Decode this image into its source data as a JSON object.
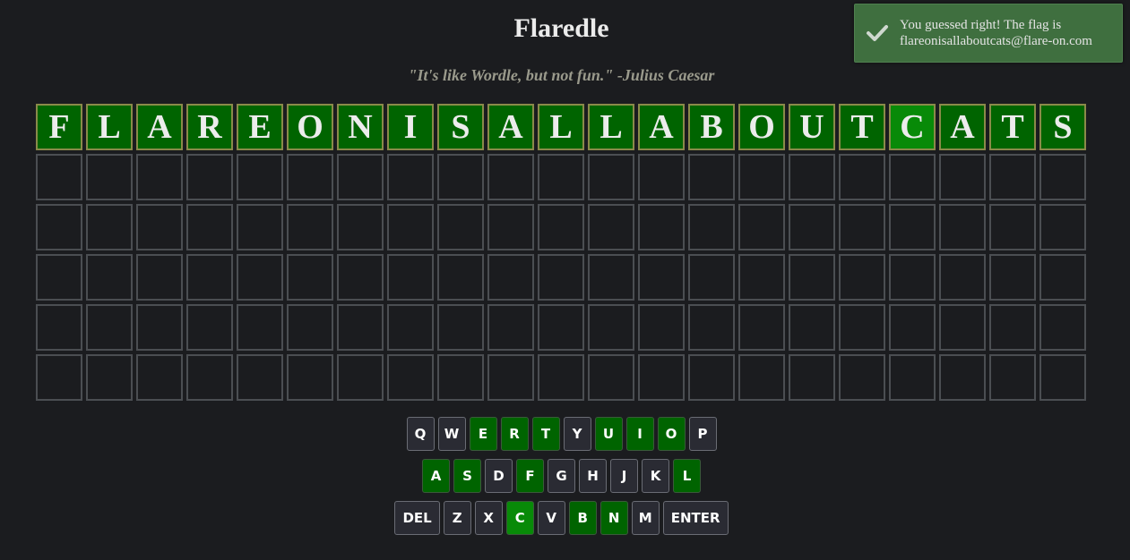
{
  "header": {
    "title": "Flaredle",
    "subtitle": "\"It's like Wordle, but not fun.\" -Julius Caesar"
  },
  "toast": {
    "icon": "check-icon",
    "line1": "You guessed right! The flag is",
    "line2": "flareonisallaboutcats@flare-on.com"
  },
  "board": {
    "columns": 21,
    "rows": 6,
    "guesses": [
      [
        "F",
        "L",
        "A",
        "R",
        "E",
        "O",
        "N",
        "I",
        "S",
        "A",
        "L",
        "L",
        "A",
        "B",
        "O",
        "U",
        "T",
        "C",
        "A",
        "T",
        "S"
      ]
    ]
  },
  "keyboard": {
    "rows": [
      [
        {
          "label": "Q",
          "state": "unused"
        },
        {
          "label": "W",
          "state": "unused"
        },
        {
          "label": "E",
          "state": "correct"
        },
        {
          "label": "R",
          "state": "correct"
        },
        {
          "label": "T",
          "state": "correct"
        },
        {
          "label": "Y",
          "state": "unused"
        },
        {
          "label": "U",
          "state": "correct"
        },
        {
          "label": "I",
          "state": "correct"
        },
        {
          "label": "O",
          "state": "correct"
        },
        {
          "label": "P",
          "state": "unused"
        }
      ],
      [
        {
          "label": "A",
          "state": "correct"
        },
        {
          "label": "S",
          "state": "correct"
        },
        {
          "label": "D",
          "state": "unused"
        },
        {
          "label": "F",
          "state": "correct"
        },
        {
          "label": "G",
          "state": "unused"
        },
        {
          "label": "H",
          "state": "unused"
        },
        {
          "label": "J",
          "state": "unused"
        },
        {
          "label": "K",
          "state": "unused"
        },
        {
          "label": "L",
          "state": "correct"
        }
      ],
      [
        {
          "label": "DEL",
          "state": "unused"
        },
        {
          "label": "Z",
          "state": "unused"
        },
        {
          "label": "X",
          "state": "unused"
        },
        {
          "label": "C",
          "state": "correct"
        },
        {
          "label": "V",
          "state": "unused"
        },
        {
          "label": "B",
          "state": "correct"
        },
        {
          "label": "N",
          "state": "correct"
        },
        {
          "label": "M",
          "state": "unused"
        },
        {
          "label": "ENTER",
          "state": "unused"
        }
      ]
    ]
  },
  "colors": {
    "background": "#1b1c1f",
    "correct": "#006400",
    "correct_bright": "#088a08",
    "toast": "#3f6f3f",
    "key": "#2a2b33",
    "empty_border": "#4b4e52"
  }
}
